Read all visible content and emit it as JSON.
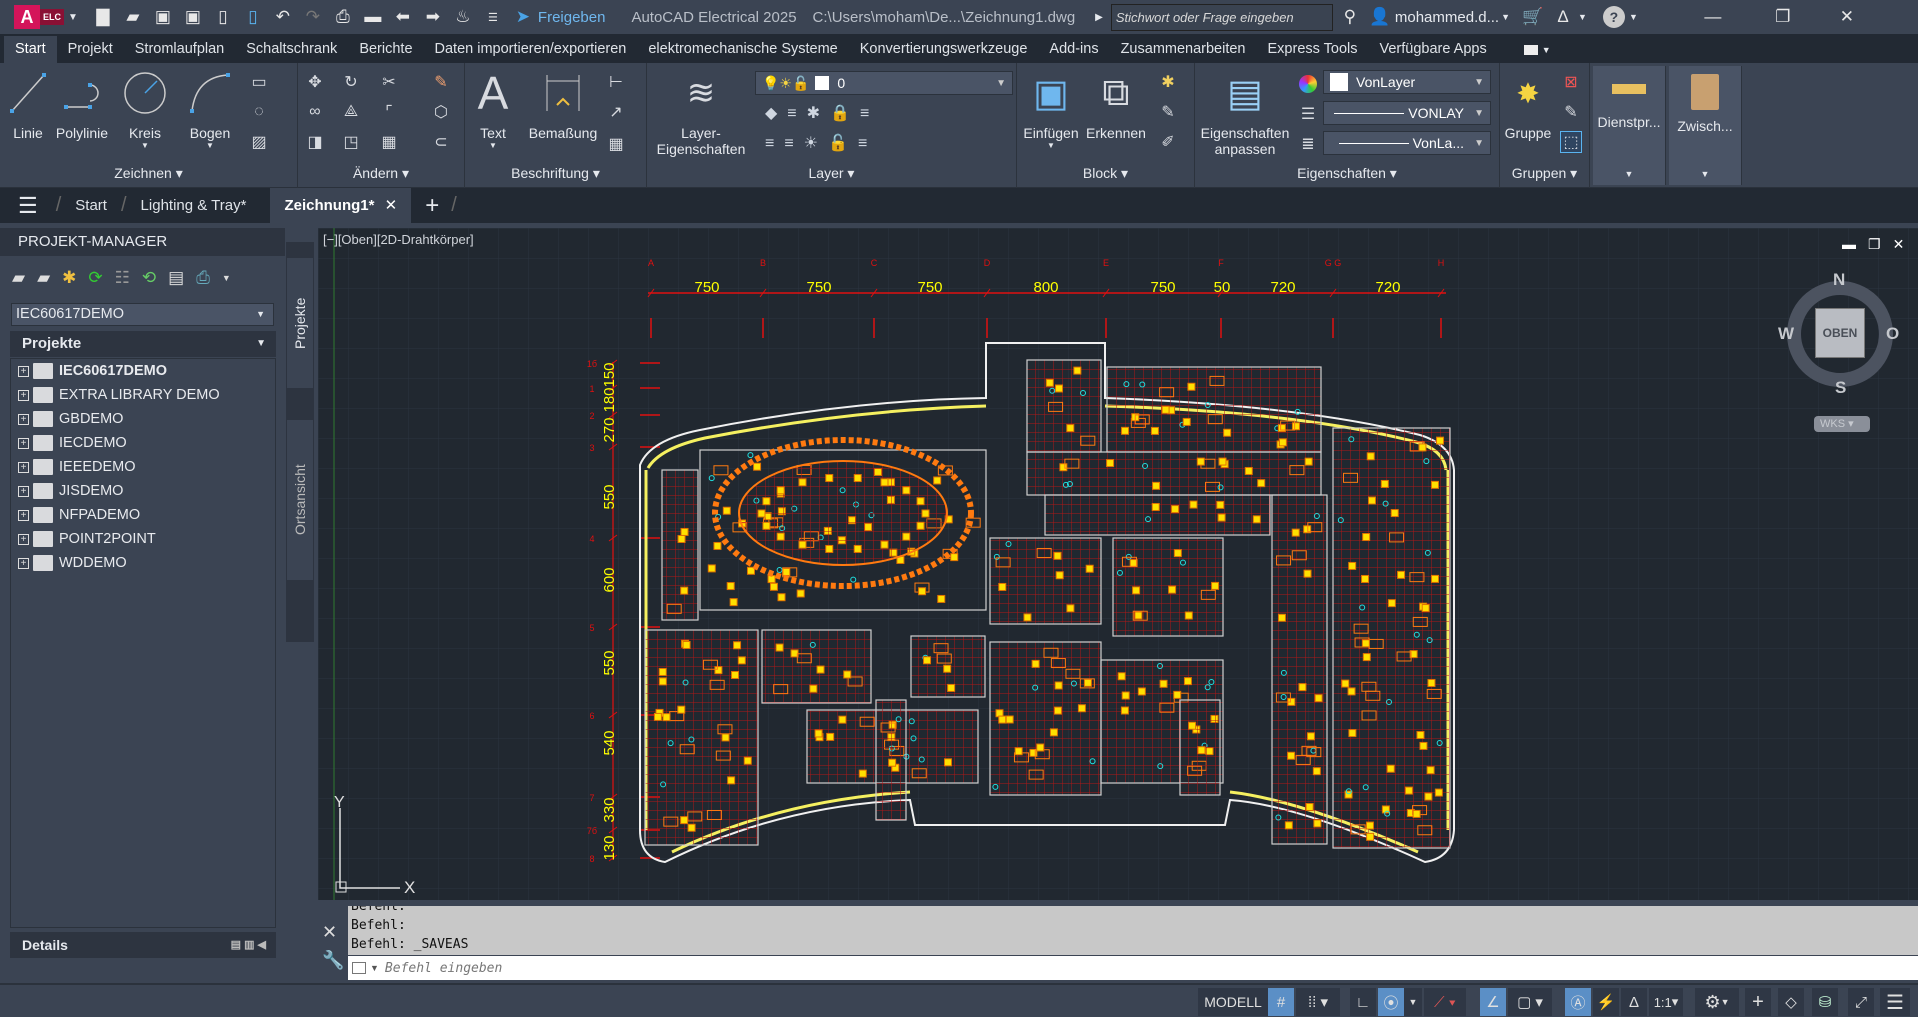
{
  "titlebar": {
    "app_logo": "A",
    "app_badge": "ELC",
    "share_label": "Freigeben",
    "app_title": "AutoCAD Electrical 2025",
    "file_path": "C:\\Users\\moham\\De...\\Zeichnung1.dwg",
    "search_placeholder": "Stichwort oder Frage eingeben",
    "user": "mohammed.d...",
    "icons": [
      "new-icon",
      "open-icon",
      "save-icon",
      "saveas-icon",
      "open-from-mobile-icon",
      "save-to-mobile-icon",
      "undo-icon",
      "redo-icon",
      "plot-icon",
      "publish-icon",
      "back-icon",
      "forward-icon",
      "workspace-icon",
      "share-icon",
      "search-icon",
      "user-icon",
      "cart-icon",
      "autodesk-icon",
      "help-icon"
    ]
  },
  "menu_tabs": [
    "Start",
    "Projekt",
    "Stromlaufplan",
    "Schaltschrank",
    "Berichte",
    "Daten importieren/exportieren",
    "elektromechanische Systeme",
    "Konvertierungswerkzeuge",
    "Add-ins",
    "Zusammenarbeiten",
    "Express Tools",
    "Verfügbare Apps"
  ],
  "ribbon": {
    "zeichnen": {
      "title": "Zeichnen",
      "linie": "Linie",
      "polylinie": "Polylinie",
      "kreis": "Kreis",
      "bogen": "Bogen"
    },
    "aendern": {
      "title": "Ändern"
    },
    "beschriftung": {
      "title": "Beschriftung",
      "text": "Text",
      "bemassung": "Bemaßung"
    },
    "layer": {
      "title": "Layer",
      "props_1": "Layer-",
      "props_2": "Eigenschaften",
      "current": "0"
    },
    "block": {
      "title": "Block",
      "insert": "Einfügen",
      "detect": "Erkennen"
    },
    "eigenschaften": {
      "title": "Eigenschaften",
      "match_1": "Eigenschaften",
      "match_2": "anpassen",
      "color": "VonLayer",
      "lineweight": "VONLAY",
      "linetype": "VonLa..."
    },
    "gruppen": {
      "title": "Gruppen",
      "group": "Gruppe"
    },
    "dienstprogramme": {
      "label": "Dienstpr..."
    },
    "zwischenablage": {
      "label": "Zwisch..."
    }
  },
  "file_tabs": {
    "start": "Start",
    "tab1": "Lighting & Tray*",
    "tab2": "Zeichnung1*"
  },
  "project_manager": {
    "title": "PROJEKT-MANAGER",
    "selected_project": "IEC60617DEMO",
    "section": "Projekte",
    "projects": [
      {
        "name": "IEC60617DEMO",
        "active": true
      },
      {
        "name": "EXTRA LIBRARY DEMO"
      },
      {
        "name": "GBDEMO"
      },
      {
        "name": "IECDEMO"
      },
      {
        "name": "IEEEDEMO"
      },
      {
        "name": "JISDEMO"
      },
      {
        "name": "NFPADEMO"
      },
      {
        "name": "POINT2POINT"
      },
      {
        "name": "WDDEMO"
      }
    ],
    "side_tabs": [
      "Projekte",
      "Ortsansicht"
    ],
    "details": "Details"
  },
  "viewport": {
    "label": "[−][Oben][2D-Drahtkörper]",
    "viewcube": {
      "top": "OBEN",
      "n": "N",
      "s": "S",
      "w": "W",
      "e": "O",
      "ucs": "WKS"
    },
    "ucs_x": "X",
    "ucs_y": "Y",
    "grid_columns": [
      "A",
      "B",
      "C",
      "D",
      "E",
      "F",
      "G G",
      "H"
    ],
    "dims_horizontal": [
      "750",
      "750",
      "750",
      "800",
      "750",
      "50",
      "720",
      "720"
    ],
    "dims_vertical": [
      "150",
      "180",
      "270",
      "550",
      "600",
      "550",
      "540",
      "330",
      "130"
    ],
    "grid_rows": [
      "1б",
      "1",
      "2",
      "3",
      "4",
      "5",
      "6",
      "7",
      "7б",
      "8"
    ]
  },
  "command_line": {
    "history": [
      "Befehl:",
      "Befehl:",
      "Befehl: _SAVEAS"
    ],
    "placeholder": "Befehl eingeben"
  },
  "statusbar": {
    "model": "MODELL",
    "scale": "1:1"
  }
}
